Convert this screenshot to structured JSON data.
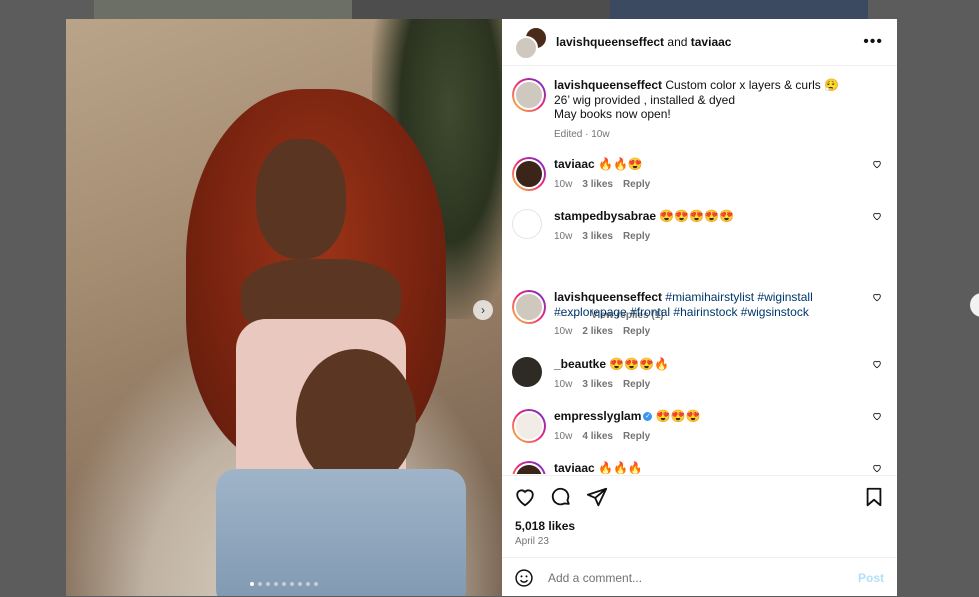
{
  "header": {
    "user1": "lavishqueenseffect",
    "joiner": "and",
    "user2": "taviaac",
    "more_label": "•••"
  },
  "caption": {
    "username": "lavishqueenseffect",
    "line1": "Custom color x layers & curls 😮‍💨",
    "line2": "26’ wig provided , installed & dyed",
    "line3": "May books now open!",
    "meta": "Edited · 10w"
  },
  "comments": [
    {
      "username": "taviaac",
      "text": "🔥🔥😍",
      "time": "10w",
      "likes": "3 likes",
      "reply": "Reply"
    },
    {
      "username": "stampedbysabrae",
      "text": "😍😍😍😍😍",
      "time": "10w",
      "likes": "3 likes",
      "reply": "Reply"
    },
    {
      "username": "lavishqueenseffect",
      "text": "#miamihairstylist #wiginstall #explorepage #frontal #hairinstock #wigsinstock",
      "time": "10w",
      "likes": "2 likes",
      "reply": "Reply"
    },
    {
      "username": "_beautke",
      "text": "😍😍😍🔥",
      "time": "10w",
      "likes": "3 likes",
      "reply": "Reply"
    },
    {
      "username": "empresslyglam",
      "text": "😍😍😍",
      "time": "10w",
      "likes": "4 likes",
      "reply": "Reply"
    },
    {
      "username": "taviaac",
      "text": "🔥🔥🔥"
    }
  ],
  "view_replies": "View replies (1)",
  "likes_count": "5,018 likes",
  "post_date": "April 23",
  "add_comment": {
    "placeholder": "Add a comment...",
    "post_label": "Post"
  },
  "carousel": {
    "count": 9,
    "active_index": 0
  },
  "colors": {
    "link": "#00376b",
    "post_button": "#b2dffc",
    "secondary_text": "#737373"
  },
  "icons": [
    "heart-icon",
    "comment-icon",
    "share-icon",
    "bookmark-icon",
    "emoji-icon",
    "more-icon",
    "chevron-right-icon",
    "verified-icon"
  ]
}
